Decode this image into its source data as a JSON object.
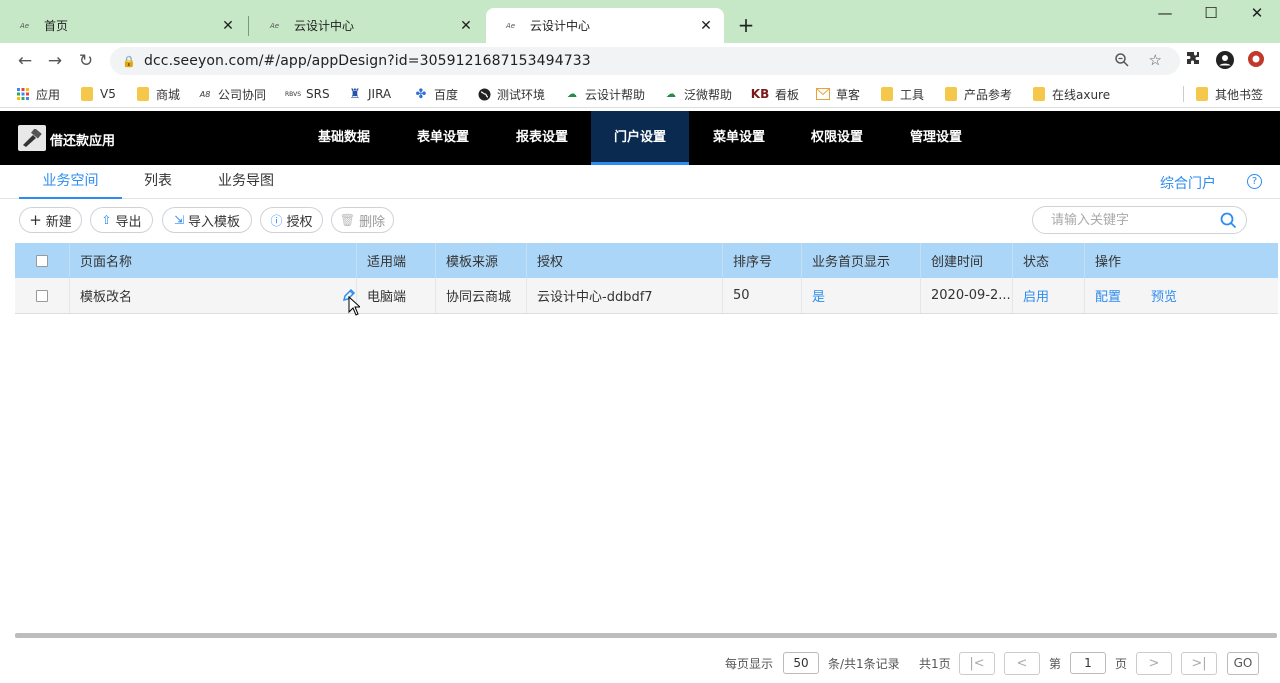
{
  "browser": {
    "tabs": [
      {
        "title": "首页",
        "favicon": "seeyon-logo-icon"
      },
      {
        "title": "云设计中心",
        "favicon": "seeyon-logo-icon"
      },
      {
        "title": "云设计中心",
        "favicon": "seeyon-logo-icon",
        "active": true
      }
    ],
    "url": "dcc.seeyon.com/#/app/appDesign?id=3059121687153494733",
    "bookmarks": [
      {
        "label": "应用",
        "icon": "apps-grid-icon"
      },
      {
        "label": "V5",
        "icon": "folder-icon"
      },
      {
        "label": "商城",
        "icon": "folder-icon"
      },
      {
        "label": "公司协同",
        "icon": "site-icon"
      },
      {
        "label": "SRS",
        "icon": "site-icon"
      },
      {
        "label": "JIRA",
        "icon": "jira-icon"
      },
      {
        "label": "百度",
        "icon": "baidu-icon"
      },
      {
        "label": "测试环境",
        "icon": "globe-icon"
      },
      {
        "label": "云设计帮助",
        "icon": "site-icon"
      },
      {
        "label": "泛微帮助",
        "icon": "site-icon"
      },
      {
        "label": "看板",
        "icon": "kb-icon"
      },
      {
        "label": "草客",
        "icon": "mail-icon"
      },
      {
        "label": "工具",
        "icon": "folder-icon"
      },
      {
        "label": "产品参考",
        "icon": "folder-icon"
      },
      {
        "label": "在线axure",
        "icon": "folder-icon"
      },
      {
        "label": "其他书签",
        "icon": "folder-icon"
      }
    ]
  },
  "app": {
    "name": "借还款应用",
    "nav": [
      "基础数据",
      "表单设置",
      "报表设置",
      "门户设置",
      "菜单设置",
      "权限设置",
      "管理设置"
    ],
    "active_nav": "门户设置"
  },
  "subtabs": {
    "items": [
      "业务空间",
      "列表",
      "业务导图"
    ],
    "active": "业务空间",
    "portal_link": "综合门户"
  },
  "actions": {
    "new": "新建",
    "export": "导出",
    "import_template": "导入模板",
    "authorize": "授权",
    "delete": "删除",
    "search_placeholder": "请输入关键字"
  },
  "table": {
    "columns": [
      "页面名称",
      "适用端",
      "模板来源",
      "授权",
      "排序号",
      "业务首页显示",
      "创建时间",
      "状态",
      "操作"
    ],
    "rows": [
      {
        "name": "模板改名",
        "platform": "电脑端",
        "source": "协同云商城",
        "auth": "云设计中心-ddbdf7",
        "order": "50",
        "homepage": "是",
        "created": "2020-09-2...",
        "status": "启用",
        "op_config": "配置",
        "op_preview": "预览"
      }
    ]
  },
  "pager": {
    "per_page_label": "每页显示",
    "per_page": "50",
    "records": "条/共1条记录",
    "total_pages": "共1页",
    "page_prefix": "第",
    "page": "1",
    "page_suffix": "页",
    "go": "GO"
  },
  "colors": {
    "accent": "#2d8cf0",
    "header_bg": "#000000",
    "active_nav_bg": "#0b2a4f",
    "table_head_bg": "#acd6f7",
    "tabstrip_bg": "#c6e8c6"
  }
}
